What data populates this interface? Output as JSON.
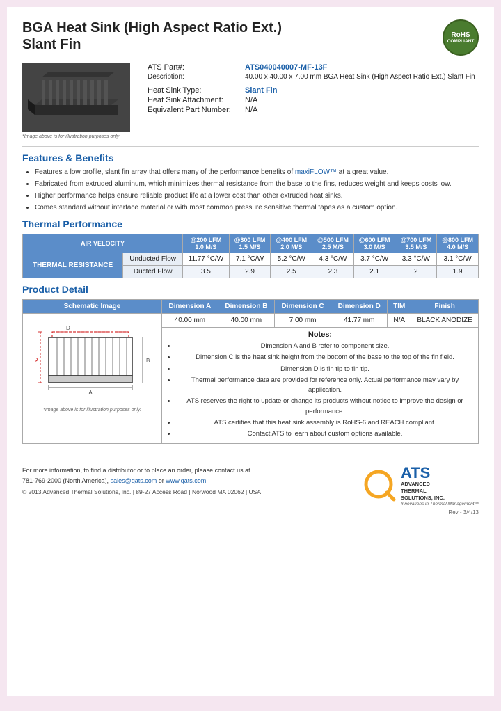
{
  "header": {
    "title_line1": "BGA Heat Sink (High Aspect Ratio Ext.)",
    "title_line2": "Slant Fin",
    "rohs": "RoHS",
    "compliant": "COMPLIANT"
  },
  "specs": {
    "part_label": "ATS Part#:",
    "part_number": "ATS040040007-MF-13F",
    "description_label": "Description:",
    "description_value": "40.00 x 40.00 x 7.00 mm  BGA Heat Sink (High Aspect Ratio Ext.) Slant Fin",
    "type_label": "Heat Sink Type:",
    "type_value": "Slant Fin",
    "attachment_label": "Heat Sink Attachment:",
    "attachment_value": "N/A",
    "equiv_label": "Equivalent Part Number:",
    "equiv_value": "N/A"
  },
  "image_caption": "*Image above is for illustration purposes only",
  "features": {
    "section_title": "Features & Benefits",
    "items": [
      "Features a low profile, slant fin array that offers many of the performance benefits of maxiFLOW™ at a great value.",
      "Fabricated from extruded aluminum, which minimizes thermal resistance from the base to the fins, reduces weight and keeps costs low.",
      "Higher performance helps ensure reliable product life at a lower cost than other extruded heat sinks.",
      "Comes standard without interface material or with most common pressure sensitive thermal tapes as a custom option."
    ]
  },
  "thermal": {
    "section_title": "Thermal Performance",
    "col_header_first": "AIR VELOCITY",
    "columns": [
      {
        "lfm": "@200 LFM",
        "ms": "1.0 M/S"
      },
      {
        "lfm": "@300 LFM",
        "ms": "1.5 M/S"
      },
      {
        "lfm": "@400 LFM",
        "ms": "2.0 M/S"
      },
      {
        "lfm": "@500 LFM",
        "ms": "2.5 M/S"
      },
      {
        "lfm": "@600 LFM",
        "ms": "3.0 M/S"
      },
      {
        "lfm": "@700 LFM",
        "ms": "3.5 M/S"
      },
      {
        "lfm": "@800 LFM",
        "ms": "4.0 M/S"
      }
    ],
    "row_label": "THERMAL RESISTANCE",
    "rows": [
      {
        "label": "Unducted Flow",
        "values": [
          "11.77 °C/W",
          "7.1 °C/W",
          "5.2 °C/W",
          "4.3 °C/W",
          "3.7 °C/W",
          "3.3 °C/W",
          "3.1 °C/W"
        ]
      },
      {
        "label": "Ducted Flow",
        "values": [
          "3.5",
          "2.9",
          "2.5",
          "2.3",
          "2.1",
          "2",
          "1.9"
        ]
      }
    ]
  },
  "detail": {
    "section_title": "Product Detail",
    "columns": [
      "Schematic Image",
      "Dimension A",
      "Dimension B",
      "Dimension C",
      "Dimension D",
      "TIM",
      "Finish"
    ],
    "values": [
      "40.00 mm",
      "40.00 mm",
      "7.00 mm",
      "41.77 mm",
      "N/A",
      "BLACK ANODIZE"
    ],
    "image_caption": "*Image above is for illustration purposes only.",
    "notes_title": "Notes:",
    "notes": [
      "Dimension A and B refer to component size.",
      "Dimension C is the heat sink height from the bottom of the base to the top of the fin field.",
      "Dimension D is fin tip to fin tip.",
      "Thermal performance data are provided for reference only. Actual performance may vary by application.",
      "ATS reserves the right to update or change its products without notice to improve the design or performance.",
      "ATS certifies that this heat sink assembly is RoHS-6 and REACH compliant.",
      "Contact ATS to learn about custom options available."
    ]
  },
  "footer": {
    "contact_line1": "For more information, to find a distributor or to place an order, please contact us at",
    "contact_line2": "781-769-2000 (North America),",
    "email": "sales@qats.com",
    "contact_or": " or ",
    "website": "www.qats.com",
    "copyright": "© 2013 Advanced Thermal Solutions, Inc.  |  89-27 Access Road  |  Norwood MA  02062  |  USA",
    "ats_big": "ATS",
    "ats_full_line1": "ADVANCED",
    "ats_full_line2": "THERMAL",
    "ats_full_line3": "SOLUTIONS, INC.",
    "ats_tagline": "Innovations in Thermal Management™",
    "page_num": "Rev - 3/4/13"
  }
}
